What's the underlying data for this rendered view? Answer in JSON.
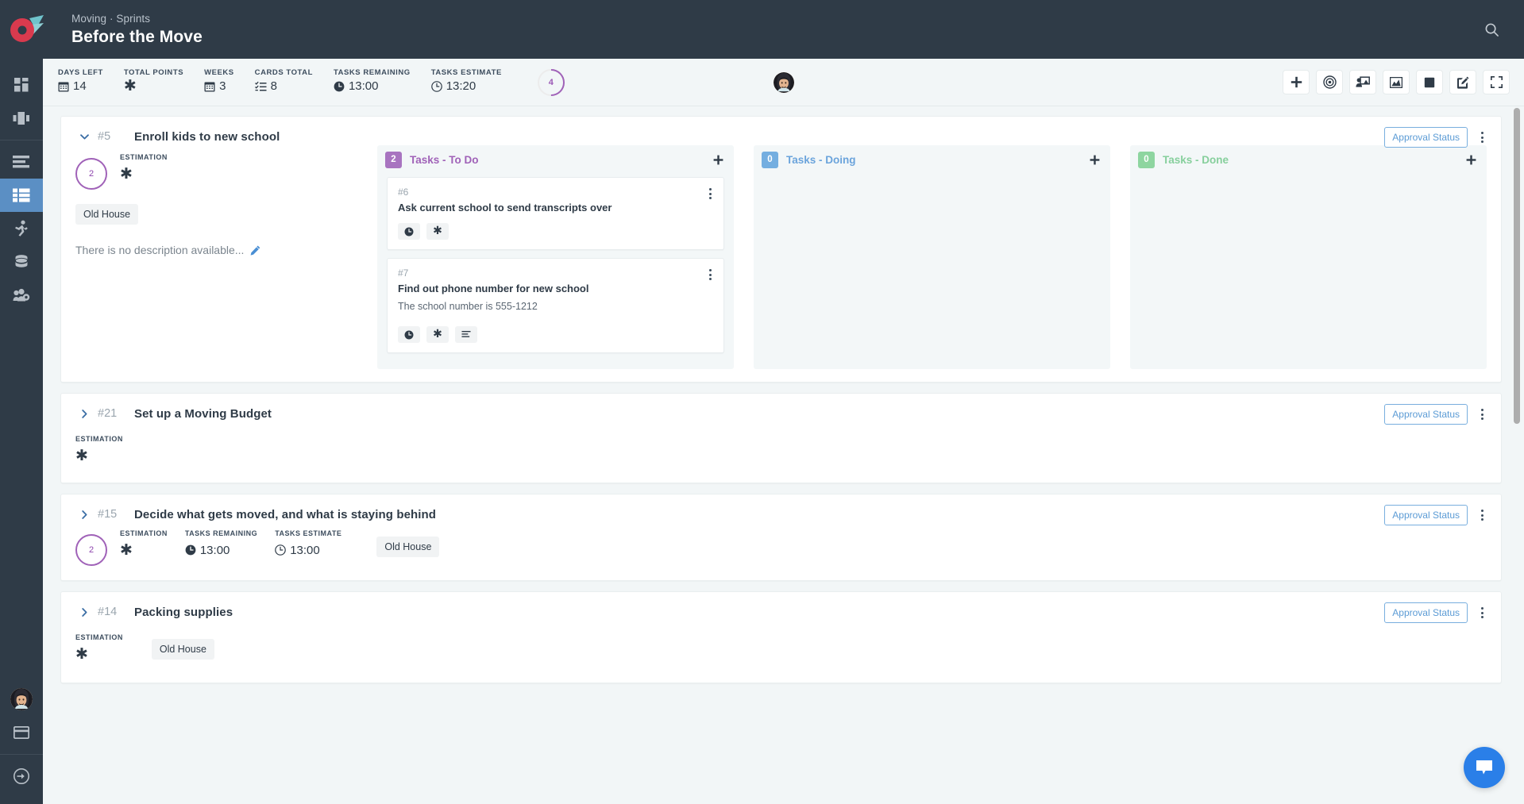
{
  "header": {
    "breadcrumb": "Moving · Sprints",
    "title": "Before the Move",
    "logo_colors": {
      "circle": "#d93a4e",
      "arrow": "#6fc3cc"
    },
    "search_icon": "search-icon"
  },
  "sidebar": {
    "items": [
      {
        "icon": "dashboard-grid-icon",
        "active": false
      },
      {
        "icon": "kanban-columns-icon",
        "active": false
      },
      {
        "icon": "backlog-list-icon",
        "active": false
      },
      {
        "icon": "board-table-icon",
        "active": true
      },
      {
        "icon": "sprint-runner-icon",
        "active": false
      },
      {
        "icon": "database-icon",
        "active": false
      },
      {
        "icon": "team-settings-icon",
        "active": false
      }
    ],
    "bottom": [
      {
        "icon": "user-avatar",
        "active": false
      },
      {
        "icon": "billing-card-icon",
        "active": false
      },
      {
        "icon": "logout-arrow-icon",
        "active": false
      }
    ],
    "active_color": "#5b8fc4"
  },
  "stats": [
    {
      "label": "DAYS LEFT",
      "icon": "calendar-icon",
      "value": "14"
    },
    {
      "label": "TOTAL POINTS",
      "icon": "asterisk-icon",
      "value": ""
    },
    {
      "label": "WEEKS",
      "icon": "calendar-icon",
      "value": "3"
    },
    {
      "label": "CARDS TOTAL",
      "icon": "checklist-icon",
      "value": "8"
    },
    {
      "label": "TASKS REMAINING",
      "icon": "clock-filled-icon",
      "value": "13:00"
    },
    {
      "label": "TASKS ESTIMATE",
      "icon": "clock-outline-icon",
      "value": "13:20"
    }
  ],
  "progress_ring": {
    "value": "4",
    "percent": 50,
    "color": "#a062b8"
  },
  "toolbar": [
    {
      "name": "add-button",
      "icon": "plus-icon"
    },
    {
      "name": "target-button",
      "icon": "bullseye-icon"
    },
    {
      "name": "presentation-button",
      "icon": "presentation-user-icon"
    },
    {
      "name": "chart-button",
      "icon": "area-chart-icon"
    },
    {
      "name": "stop-button",
      "icon": "stop-square-icon"
    },
    {
      "name": "edit-button",
      "icon": "edit-pencil-icon"
    },
    {
      "name": "fullscreen-button",
      "icon": "fullscreen-icon"
    }
  ],
  "approval_label": "Approval Status",
  "description_placeholder": "There is no description available...",
  "stories": [
    {
      "expanded": true,
      "num": "#5",
      "title": "Enroll kids to new school",
      "estimation_points": "2",
      "meta": [
        {
          "label": "ESTIMATION",
          "icon": "asterisk-icon",
          "value": ""
        }
      ],
      "tag": "Old House",
      "description": "There is no description available...",
      "columns": [
        {
          "count": "2",
          "title": "Tasks - To Do",
          "color": "#a874c0",
          "tasks": [
            {
              "num": "#6",
              "title": "Ask current school to send transcripts over",
              "desc": "",
              "chips": [
                "clock-filled-icon",
                "asterisk-icon"
              ]
            },
            {
              "num": "#7",
              "title": "Find out phone number for new school",
              "desc": "The school number is 555-1212",
              "chips": [
                "clock-filled-icon",
                "asterisk-icon",
                "align-left-icon"
              ]
            }
          ]
        },
        {
          "count": "0",
          "title": "Tasks - Doing",
          "color": "#74aee0",
          "tasks": []
        },
        {
          "count": "0",
          "title": "Tasks - Done",
          "color": "#8ed5a0",
          "tasks": []
        }
      ]
    },
    {
      "expanded": false,
      "num": "#21",
      "title": "Set up a Moving Budget",
      "estimation_points": "",
      "meta": [
        {
          "label": "ESTIMATION",
          "icon": "asterisk-icon",
          "value": ""
        }
      ],
      "tag": "",
      "description": "",
      "columns": []
    },
    {
      "expanded": false,
      "num": "#15",
      "title": "Decide what gets moved, and what is staying behind",
      "estimation_points": "2",
      "meta": [
        {
          "label": "ESTIMATION",
          "icon": "asterisk-icon",
          "value": ""
        },
        {
          "label": "TASKS REMAINING",
          "icon": "clock-filled-icon",
          "value": "13:00"
        },
        {
          "label": "TASKS ESTIMATE",
          "icon": "clock-outline-icon",
          "value": "13:00"
        }
      ],
      "tag": "Old House",
      "description": "",
      "columns": []
    },
    {
      "expanded": false,
      "num": "#14",
      "title": "Packing supplies",
      "estimation_points": "",
      "meta": [
        {
          "label": "ESTIMATION",
          "icon": "asterisk-icon",
          "value": ""
        }
      ],
      "tag": "Old House",
      "description": "",
      "columns": []
    }
  ],
  "chat": {
    "icon": "chat-bubble-icon",
    "color": "#2a7fe8"
  }
}
